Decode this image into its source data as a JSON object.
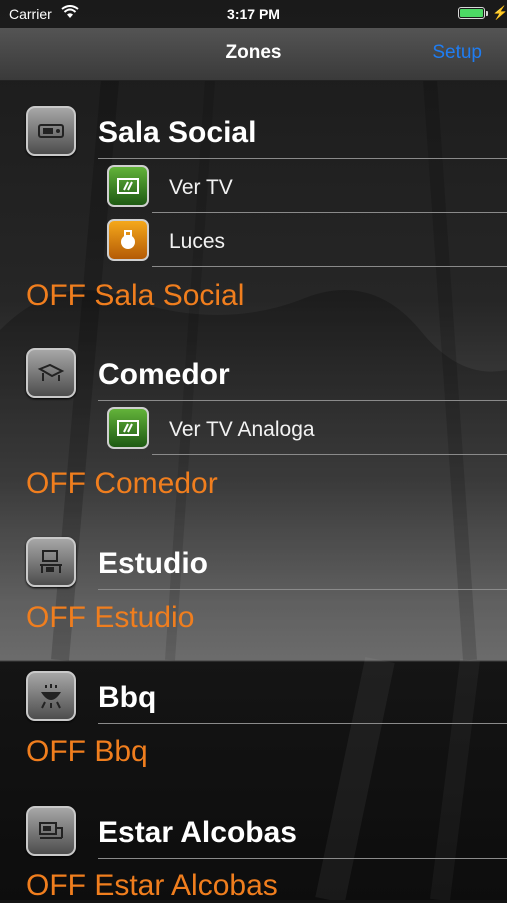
{
  "status_bar": {
    "carrier": "Carrier",
    "time": "3:17 PM"
  },
  "nav": {
    "title": "Zones",
    "setup": "Setup"
  },
  "zones": [
    {
      "title": "Sala Social",
      "icon": "tv-room-icon",
      "scenes": [
        {
          "label": "Ver TV",
          "icon": "tv-icon",
          "color": "green"
        },
        {
          "label": "Luces",
          "icon": "light-bulb-icon",
          "color": "orange"
        }
      ],
      "off": "OFF Sala Social"
    },
    {
      "title": "Comedor",
      "icon": "dining-room-icon",
      "scenes": [
        {
          "label": "Ver TV Analoga",
          "icon": "tv-icon",
          "color": "green"
        }
      ],
      "off": "OFF Comedor"
    },
    {
      "title": "Estudio",
      "icon": "study-desk-icon",
      "scenes": [],
      "off": "OFF Estudio"
    },
    {
      "title": "Bbq",
      "icon": "grill-icon",
      "scenes": [],
      "off": "OFF Bbq"
    },
    {
      "title": "Estar Alcobas",
      "icon": "bedroom-icon",
      "scenes": [],
      "off": "OFF Estar Alcobas"
    }
  ],
  "colors": {
    "accent": "#1f7df2",
    "off_text": "#f07e1e",
    "scene_green": "#3f8c26",
    "scene_orange": "#e58a10"
  }
}
